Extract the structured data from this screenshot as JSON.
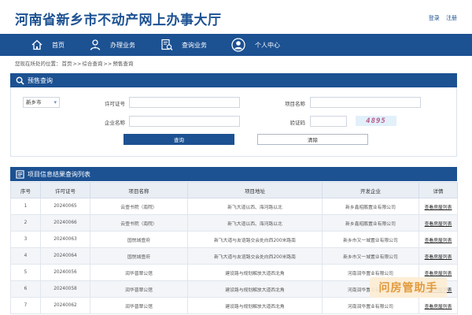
{
  "header": {
    "title": "河南省新乡市不动产网上办事大厅",
    "login": "登录",
    "register": "注册"
  },
  "nav": {
    "items": [
      {
        "label": "首页"
      },
      {
        "label": "办理业务"
      },
      {
        "label": "查询业务"
      },
      {
        "label": "个人中心"
      }
    ]
  },
  "breadcrumb": {
    "prefix": "您现在所处的位置：",
    "home": "首页",
    "sep1": ">>",
    "level2": "综合查询",
    "sep2": ">>",
    "current": "预售查询"
  },
  "presale_panel": {
    "title": "预售查询"
  },
  "form": {
    "city_select": "新乡市",
    "permit_label": "许可证号",
    "project_label": "项目名称",
    "company_label": "企业名称",
    "captcha_label": "验证码",
    "captcha_text": "4895",
    "query_button": "查询",
    "clear_button": "清除"
  },
  "results_panel": {
    "title": "项目信息结果查询列表"
  },
  "table": {
    "headers": [
      "序号",
      "许可证号",
      "项目名称",
      "项目地址",
      "开发企业",
      "详情"
    ],
    "rows": [
      [
        "1",
        "20240065",
        "云壹书院（南院）",
        "新飞大道以西、海河路以北",
        "新乡鑫昭鹏置业有限公司",
        "查看房屋列表"
      ],
      [
        "2",
        "20240066",
        "云壹书院（南院）",
        "新飞大道以西、海河路以北",
        "新乡鑫昭鹏置业有限公司",
        "查看房屋列表"
      ],
      [
        "3",
        "20240063",
        "国悦城壹府",
        "新飞大道与友谊路交会处向西200米路南",
        "新乡市又一城置业有限公司",
        "查看房屋列表"
      ],
      [
        "4",
        "20240064",
        "国悦城壹府",
        "新飞大道与友谊路交会处向西200米路南",
        "新乡市又一城置业有限公司",
        "查看房屋列表"
      ],
      [
        "5",
        "20240056",
        "润华晋翠公馆",
        "建设路与规划解放大道西北角",
        "河南润华置业有限公司",
        "查看房屋列表"
      ],
      [
        "6",
        "20240058",
        "润华晋翠公馆",
        "建设路与规划解放大道西北角",
        "河南润华置业有限公司",
        "查看房屋列表"
      ],
      [
        "7",
        "20240062",
        "润华晋翠公馆",
        "建设路与规划解放大道西北角",
        "河南润华置业有限公司",
        "查看房屋列表"
      ]
    ]
  },
  "watermark": "问房管助手",
  "colors": {
    "primary": "#1c5192",
    "captcha": "#b95a8d",
    "watermark": "#e19a3c"
  }
}
